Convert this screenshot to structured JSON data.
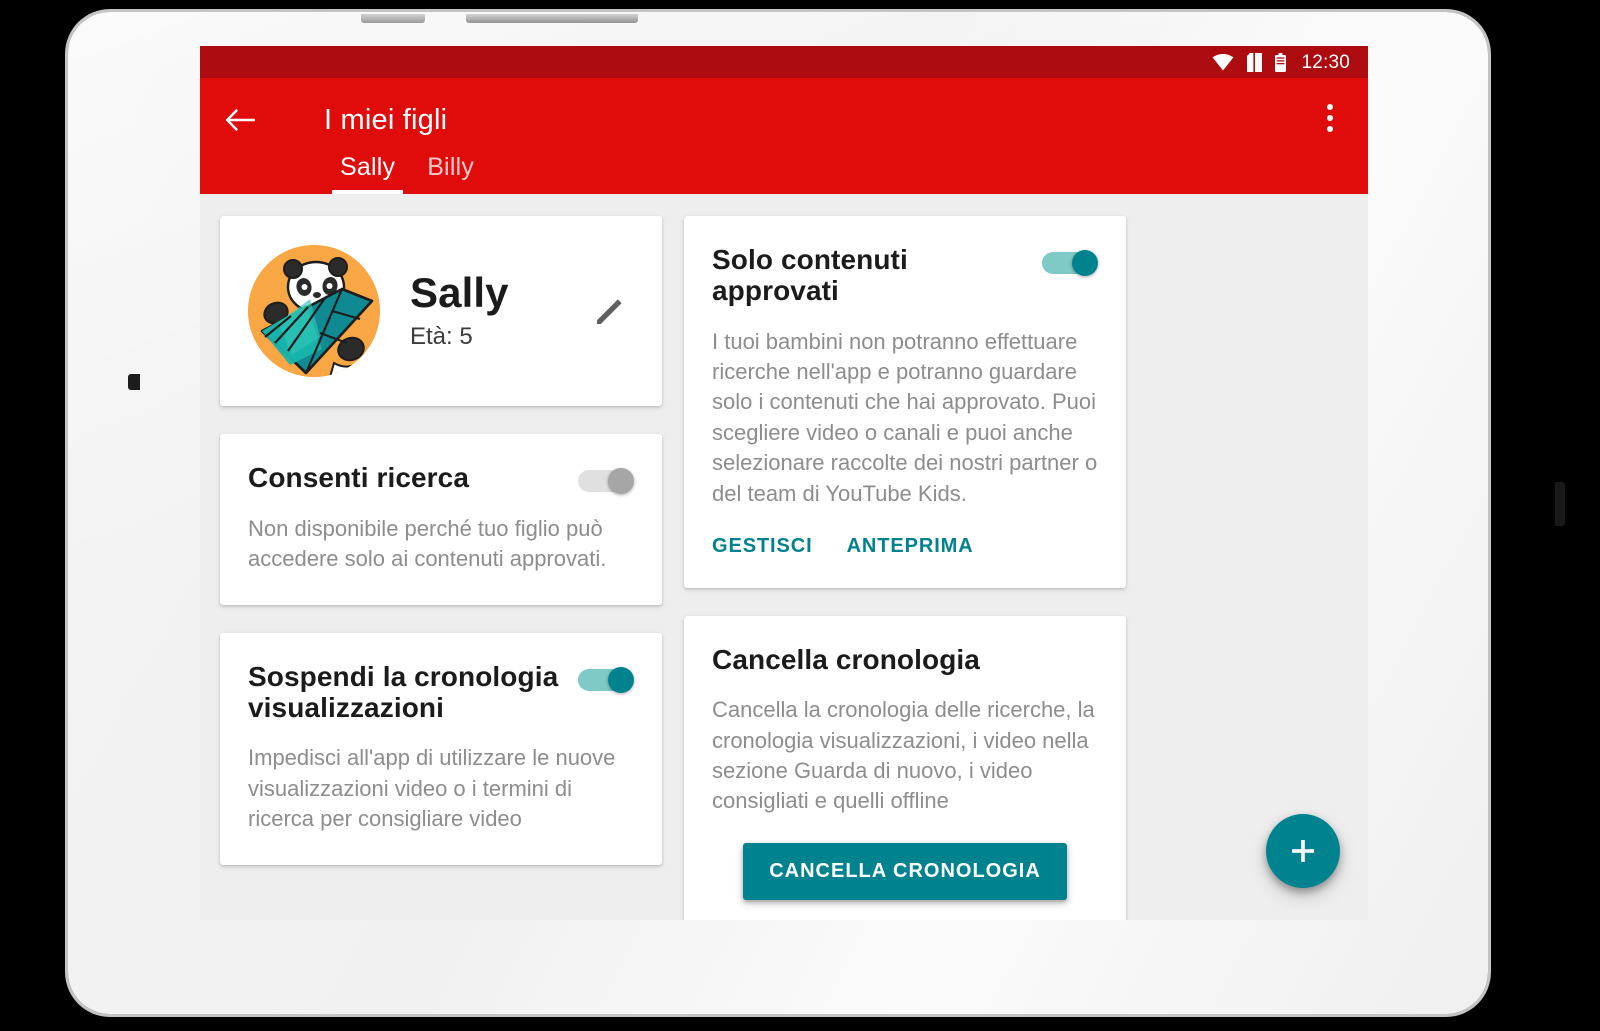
{
  "status_bar": {
    "time": "12:30",
    "icons": [
      "wifi-icon",
      "sim-card-icon",
      "battery-icon"
    ]
  },
  "app_bar": {
    "back_icon": "back-arrow-icon",
    "title": "I miei figli",
    "overflow_icon": "more-vertical-icon",
    "tabs": [
      {
        "label": "Sally",
        "active": true
      },
      {
        "label": "Billy",
        "active": false
      }
    ]
  },
  "profile": {
    "avatar_icon": "panda-leaf-avatar",
    "name": "Sally",
    "age_label": "Età: 5",
    "edit_icon": "pencil-icon"
  },
  "cards": {
    "allow_search": {
      "title": "Consenti ricerca",
      "description": "Non disponibile perché tuo figlio può accedere solo ai contenuti approvati.",
      "toggle_state": "disabled"
    },
    "pause_history": {
      "title": "Sospendi la cronologia visualizzazioni",
      "description": "Impedisci all'app di utilizzare le nuove visualizzazioni video o i termini di ricerca per consigliare video",
      "toggle_state": "on"
    },
    "approved_content": {
      "title": "Solo contenuti approvati",
      "description": "I tuoi bambini non potranno effettuare ricerche nell'app e potranno guardare solo i contenuti che hai approvato. Puoi scegliere video o canali e puoi anche selezionare raccolte dei nostri partner o del team di YouTube Kids.",
      "toggle_state": "on",
      "actions": [
        "GESTISCI",
        "ANTEPRIMA"
      ]
    },
    "clear_history": {
      "title": "Cancella cronologia",
      "description": "Cancella la cronologia delle ricerche, la cronologia visualizzazioni, i video nella sezione Guarda di nuovo, i video consigliati e quelli offline",
      "button_label": "CANCELLA CRONOLOGIA"
    }
  },
  "fab": {
    "icon": "plus-icon",
    "label": "+"
  },
  "colors": {
    "app_bar_red": "#e00b0b",
    "status_bar_red": "#ac0c10",
    "accent_teal": "#00838f",
    "toggle_track_teal": "#7fc9c6",
    "content_background": "#eeeeee",
    "avatar_background": "#f9a645"
  }
}
